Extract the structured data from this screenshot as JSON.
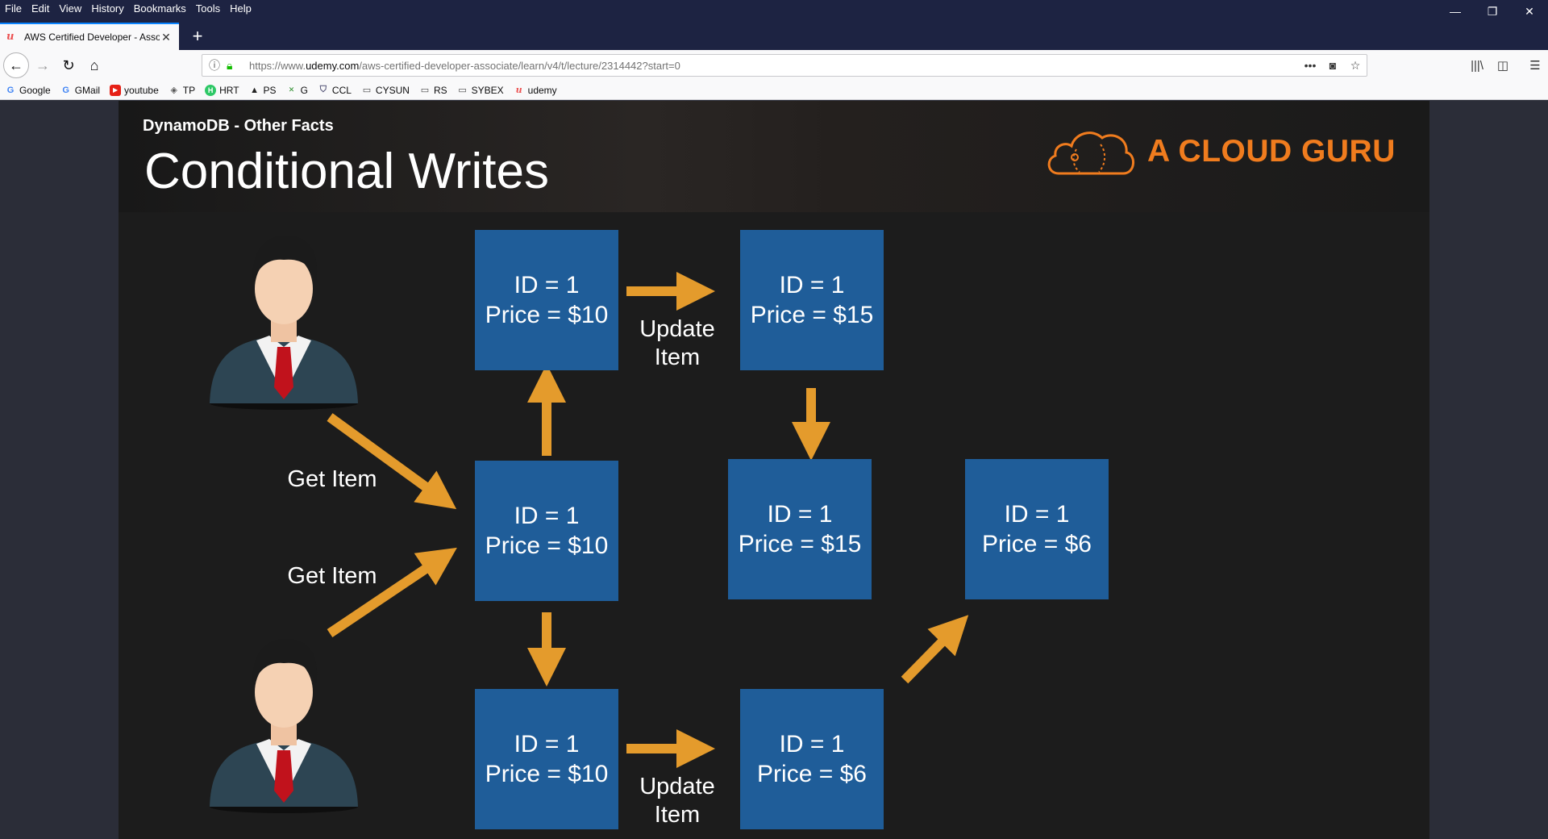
{
  "menu": [
    "File",
    "Edit",
    "View",
    "History",
    "Bookmarks",
    "Tools",
    "Help"
  ],
  "tab": {
    "title": "AWS Certified Developer - Asso",
    "favicon": "udemy-icon"
  },
  "url": {
    "prefix": "https://www.",
    "domain": "udemy.com",
    "path": "/aws-certified-developer-associate/learn/v4/t/lecture/2314442?start=0"
  },
  "bookmarks": [
    {
      "label": "Google",
      "icon": "G"
    },
    {
      "label": "GMail",
      "icon": "G"
    },
    {
      "label": "youtube",
      "icon": "▶"
    },
    {
      "label": "TP",
      "icon": "◈"
    },
    {
      "label": "HRT",
      "icon": "H"
    },
    {
      "label": "PS",
      "icon": "▲"
    },
    {
      "label": "G",
      "icon": "✕"
    },
    {
      "label": "CCL",
      "icon": "⛉"
    },
    {
      "label": "CYSUN",
      "icon": "▭"
    },
    {
      "label": "RS",
      "icon": "▭"
    },
    {
      "label": "SYBEX",
      "icon": "▭"
    },
    {
      "label": "udemy",
      "icon": "u"
    }
  ],
  "slide": {
    "subtitle": "DynamoDB - Other Facts",
    "title": "Conditional Writes",
    "brand": "A CLOUD GURU",
    "labels": {
      "get1": "Get Item",
      "get2": "Get Item",
      "update1_a": "Update",
      "update1_b": "Item",
      "update2_a": "Update",
      "update2_b": "Item"
    },
    "boxes": {
      "top_left": {
        "id": "ID = 1",
        "price": "Price = $10"
      },
      "top_right": {
        "id": "ID = 1",
        "price": "Price = $15"
      },
      "mid_left": {
        "id": "ID = 1",
        "price": "Price = $10"
      },
      "mid_center": {
        "id": "ID = 1",
        "price": "Price = $15"
      },
      "mid_right": {
        "id": "ID = 1",
        "price": "Price = $6"
      },
      "bot_left": {
        "id": "ID = 1",
        "price": "Price = $10"
      },
      "bot_right": {
        "id": "ID = 1",
        "price": "Price = $6"
      }
    },
    "colors": {
      "box": "#1f5d99",
      "arrow": "#e49b2c",
      "brand": "#f07c1e"
    }
  }
}
